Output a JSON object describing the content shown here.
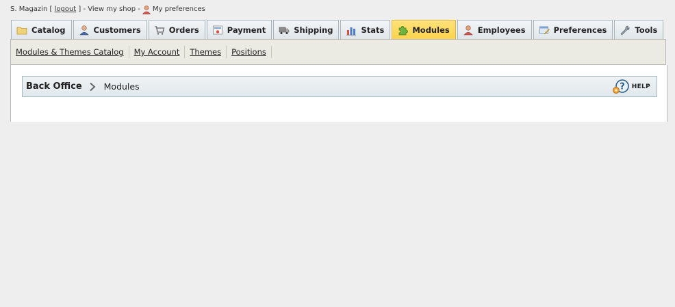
{
  "header": {
    "shop_name": "S. Magazin",
    "bracket_open": "[",
    "logout": "logout",
    "bracket_close": "]",
    "view_shop": "- View my shop -",
    "my_preferences": "My preferences"
  },
  "tabs": [
    {
      "label": "Catalog",
      "icon": "folder-icon"
    },
    {
      "label": "Customers",
      "icon": "customer-icon"
    },
    {
      "label": "Orders",
      "icon": "cart-icon"
    },
    {
      "label": "Payment",
      "icon": "payment-icon"
    },
    {
      "label": "Shipping",
      "icon": "truck-icon"
    },
    {
      "label": "Stats",
      "icon": "bar-chart-icon"
    },
    {
      "label": "Modules",
      "icon": "puzzle-icon",
      "active": true
    },
    {
      "label": "Employees",
      "icon": "employee-icon"
    },
    {
      "label": "Preferences",
      "icon": "preferences-icon"
    },
    {
      "label": "Tools",
      "icon": "wrench-icon"
    }
  ],
  "subnav": [
    "Modules & Themes Catalog",
    "My Account",
    "Themes",
    "Positions"
  ],
  "breadcrumb": {
    "root": "Back Office",
    "current": "Modules"
  },
  "help_label": "HELP",
  "colors": {
    "active_tab": "#fcd34a",
    "tab_bg": "#e4e9ec",
    "subnav_bg": "#ecebe3",
    "page_bg": "#eeeeee"
  }
}
